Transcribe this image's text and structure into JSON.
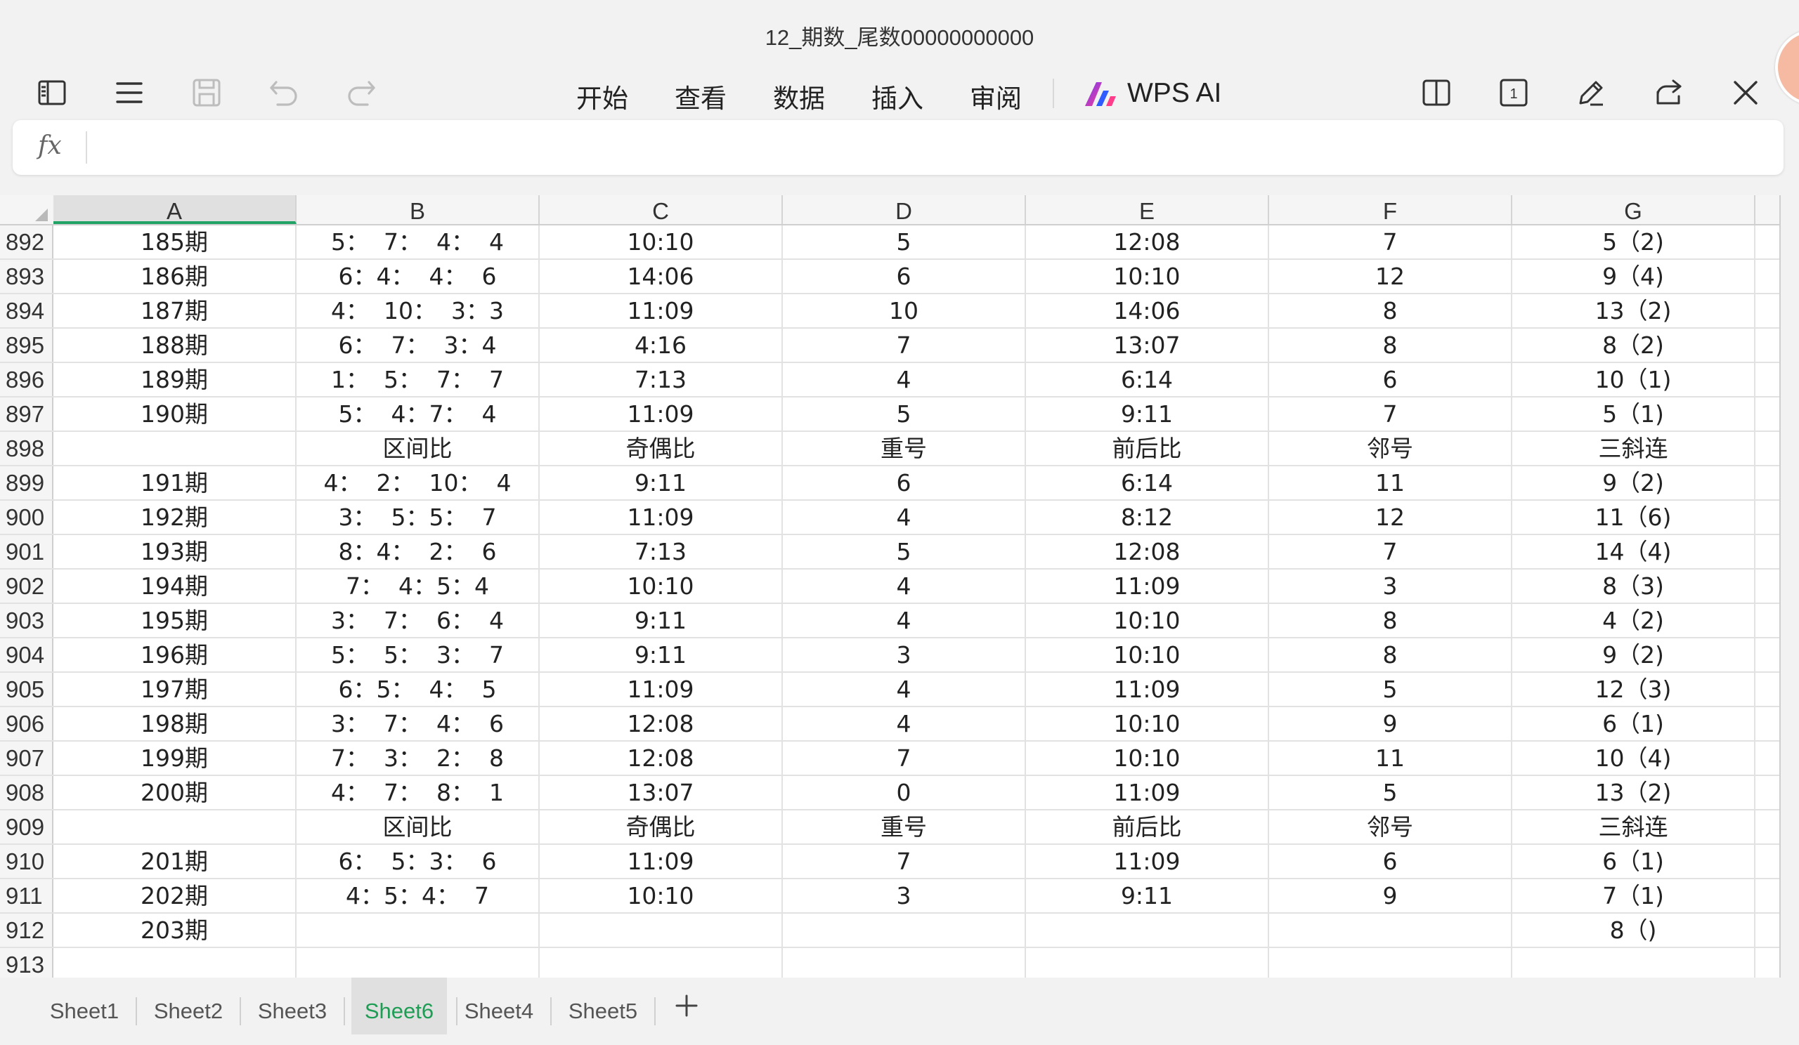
{
  "document": {
    "title": "12_期数_尾数00000000000"
  },
  "toolbar": {
    "tabs": [
      "开始",
      "查看",
      "数据",
      "插入",
      "审阅"
    ],
    "ai_label": "WPS AI",
    "page_count_badge": "1"
  },
  "formula_bar": {
    "fx_label": "fx",
    "value": ""
  },
  "columns": [
    "A",
    "B",
    "C",
    "D",
    "E",
    "F",
    "G"
  ],
  "active_column": "A",
  "rows": [
    {
      "n": "892",
      "cells": [
        "185期",
        "5：  7：  4：  4",
        "10:10",
        "5",
        "12:08",
        "7",
        "5（2)"
      ]
    },
    {
      "n": "893",
      "cells": [
        "186期",
        "6：4：  4：  6",
        "14:06",
        "6",
        "10:10",
        "12",
        "9（4)"
      ]
    },
    {
      "n": "894",
      "cells": [
        "187期",
        "4：  10：  3：3",
        "11:09",
        "10",
        "14:06",
        "8",
        "13（2)"
      ]
    },
    {
      "n": "895",
      "cells": [
        "188期",
        "6：  7：  3：4",
        "4:16",
        "7",
        "13:07",
        "8",
        "8（2)"
      ]
    },
    {
      "n": "896",
      "cells": [
        "189期",
        "1：  5：  7：  7",
        "7:13",
        "4",
        "6:14",
        "6",
        "10（1)"
      ]
    },
    {
      "n": "897",
      "cells": [
        "190期",
        "5：  4：7：  4",
        "11:09",
        "5",
        "9:11",
        "7",
        "5（1)"
      ]
    },
    {
      "n": "898",
      "cells": [
        "",
        "区间比",
        "奇偶比",
        "重号",
        "前后比",
        "邻号",
        "三斜连"
      ]
    },
    {
      "n": "899",
      "cells": [
        "191期",
        "4：  2：  10：  4",
        "9:11",
        "6",
        "6:14",
        "11",
        "9（2)"
      ]
    },
    {
      "n": "900",
      "cells": [
        "192期",
        "3：  5：5：  7",
        "11:09",
        "4",
        "8:12",
        "12",
        "11（6)"
      ]
    },
    {
      "n": "901",
      "cells": [
        "193期",
        "8：4：  2：  6",
        "7:13",
        "5",
        "12:08",
        "7",
        "14（4)"
      ]
    },
    {
      "n": "902",
      "cells": [
        "194期",
        "7：  4：5：4",
        "10:10",
        "4",
        "11:09",
        "3",
        "8（3)"
      ]
    },
    {
      "n": "903",
      "cells": [
        "195期",
        "3：  7：  6：  4",
        "9:11",
        "4",
        "10:10",
        "8",
        "4（2)"
      ]
    },
    {
      "n": "904",
      "cells": [
        "196期",
        "5：  5：  3：  7",
        "9:11",
        "3",
        "10:10",
        "8",
        "9（2)"
      ]
    },
    {
      "n": "905",
      "cells": [
        "197期",
        "6：5：  4：  5",
        "11:09",
        "4",
        "11:09",
        "5",
        "12（3)"
      ]
    },
    {
      "n": "906",
      "cells": [
        "198期",
        "3：  7：  4：  6",
        "12:08",
        "4",
        "10:10",
        "9",
        "6（1)"
      ]
    },
    {
      "n": "907",
      "cells": [
        "199期",
        "7：  3：  2：  8",
        "12:08",
        "7",
        "10:10",
        "11",
        "10（4)"
      ]
    },
    {
      "n": "908",
      "cells": [
        "200期",
        "4：  7：  8：  1",
        "13:07",
        "0",
        "11:09",
        "5",
        "13（2)"
      ]
    },
    {
      "n": "909",
      "cells": [
        "",
        "区间比",
        "奇偶比",
        "重号",
        "前后比",
        "邻号",
        "三斜连"
      ]
    },
    {
      "n": "910",
      "cells": [
        "201期",
        "6：  5：3：  6",
        "11:09",
        "7",
        "11:09",
        "6",
        "6（1)"
      ]
    },
    {
      "n": "911",
      "cells": [
        "202期",
        "4：5：4：  7",
        "10:10",
        "3",
        "9:11",
        "9",
        "7（1)"
      ]
    },
    {
      "n": "912",
      "cells": [
        "203期",
        "",
        "",
        "",
        "",
        "",
        "8（)"
      ]
    },
    {
      "n": "913",
      "cells": [
        "",
        "",
        "",
        "",
        "",
        "",
        ""
      ]
    }
  ],
  "sheet_tabs": [
    "Sheet1",
    "Sheet2",
    "Sheet3",
    "Sheet6",
    "Sheet4",
    "Sheet5"
  ],
  "active_sheet": "Sheet6",
  "colors": {
    "accent": "#21a366",
    "active_tab_text": "#1f9d55"
  }
}
